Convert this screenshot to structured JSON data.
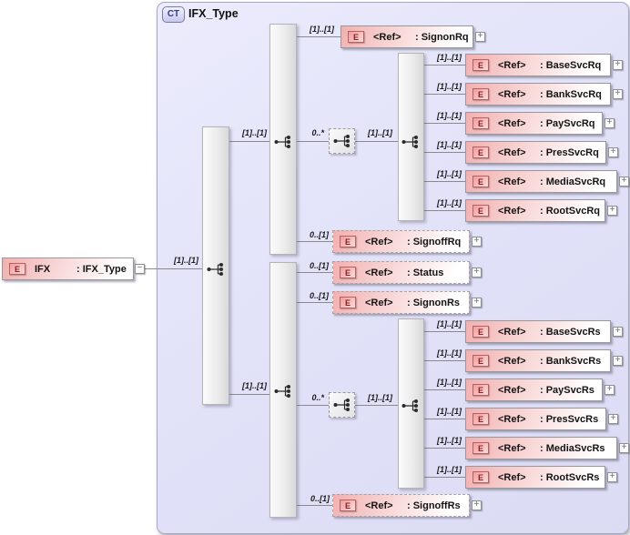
{
  "container": {
    "badge": "CT",
    "title": "IFX_Type"
  },
  "root": {
    "icon": "E",
    "name": "IFX",
    "type": ": IFX_Type",
    "cardinality": "[1]..[1]"
  },
  "connectors": {
    "seq_to_rq_bar": "[1]..[1]",
    "seq_to_rs_bar": "[1]..[1]",
    "rq_repeat": "0..*",
    "rq_repeat_to_seq": "[1]..[1]",
    "rs_repeat": "0..*",
    "rs_repeat_to_seq": "[1]..[1]"
  },
  "icons": {
    "expand": "+",
    "collapse": "−",
    "sequence": "sequence-compositor"
  },
  "colors": {
    "container_fill": "#e2e2f9",
    "element_pink": "#f2b0b0",
    "bar_gray": "#ececec",
    "wire": "#8a8a8a",
    "badge_text": "#2e3a8c"
  },
  "elements": [
    {
      "icon": "E",
      "name": "<Ref>",
      "type": ": SignonRq",
      "cardinality": "[1]..[1]",
      "optional": false
    },
    {
      "icon": "E",
      "name": "<Ref>",
      "type": ": BaseSvcRq",
      "cardinality": "[1]..[1]",
      "optional": false
    },
    {
      "icon": "E",
      "name": "<Ref>",
      "type": ": BankSvcRq",
      "cardinality": "[1]..[1]",
      "optional": false
    },
    {
      "icon": "E",
      "name": "<Ref>",
      "type": ": PaySvcRq",
      "cardinality": "[1]..[1]",
      "optional": false
    },
    {
      "icon": "E",
      "name": "<Ref>",
      "type": ": PresSvcRq",
      "cardinality": "[1]..[1]",
      "optional": false
    },
    {
      "icon": "E",
      "name": "<Ref>",
      "type": ": MediaSvcRq",
      "cardinality": "[1]..[1]",
      "optional": false
    },
    {
      "icon": "E",
      "name": "<Ref>",
      "type": ": RootSvcRq",
      "cardinality": "[1]..[1]",
      "optional": false
    },
    {
      "icon": "E",
      "name": "<Ref>",
      "type": ": SignoffRq",
      "cardinality": "0..[1]",
      "optional": true
    },
    {
      "icon": "E",
      "name": "<Ref>",
      "type": ": Status",
      "cardinality": "0..[1]",
      "optional": true
    },
    {
      "icon": "E",
      "name": "<Ref>",
      "type": ": SignonRs",
      "cardinality": "0..[1]",
      "optional": true
    },
    {
      "icon": "E",
      "name": "<Ref>",
      "type": ": BaseSvcRs",
      "cardinality": "[1]..[1]",
      "optional": false
    },
    {
      "icon": "E",
      "name": "<Ref>",
      "type": ": BankSvcRs",
      "cardinality": "[1]..[1]",
      "optional": false
    },
    {
      "icon": "E",
      "name": "<Ref>",
      "type": ": PaySvcRs",
      "cardinality": "[1]..[1]",
      "optional": false
    },
    {
      "icon": "E",
      "name": "<Ref>",
      "type": ": PresSvcRs",
      "cardinality": "[1]..[1]",
      "optional": false
    },
    {
      "icon": "E",
      "name": "<Ref>",
      "type": ": MediaSvcRs",
      "cardinality": "[1]..[1]",
      "optional": false
    },
    {
      "icon": "E",
      "name": "<Ref>",
      "type": ": RootSvcRs",
      "cardinality": "[1]..[1]",
      "optional": false
    },
    {
      "icon": "E",
      "name": "<Ref>",
      "type": ": SignoffRs",
      "cardinality": "0..[1]",
      "optional": true
    }
  ]
}
